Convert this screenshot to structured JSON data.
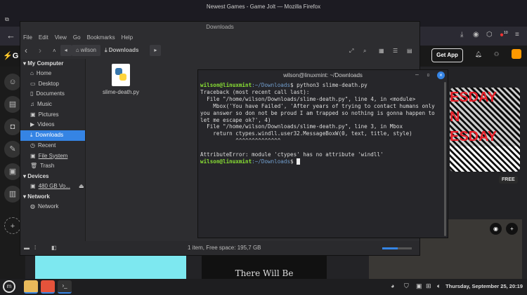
{
  "firefox": {
    "window_title": "Newest Games - Game Jolt — Mozilla Firefox",
    "notif_count": "10",
    "get_app": "Get App",
    "free_badge": "FREE",
    "art_lines": [
      "ESDAY",
      "N",
      "ESDAY"
    ],
    "bottom_art_text": "There Will Be"
  },
  "file_manager": {
    "title": "Downloads",
    "menu": [
      "File",
      "Edit",
      "View",
      "Go",
      "Bookmarks",
      "Help"
    ],
    "breadcrumbs": [
      "wilson",
      "Downloads"
    ],
    "sections": [
      {
        "label": "My Computer",
        "items": [
          "Home",
          "Desktop",
          "Documents",
          "Music",
          "Pictures",
          "Videos",
          "Downloads",
          "Recent",
          "File System",
          "Trash"
        ]
      },
      {
        "label": "Devices",
        "items": [
          "480 GB Vo..."
        ]
      },
      {
        "label": "Network",
        "items": [
          "Network"
        ]
      }
    ],
    "selected": "Downloads",
    "file": "slime-death.py",
    "status": "1 item, Free space: 195,7 GB"
  },
  "terminal": {
    "title": "wilson@linuxmint: ~/Downloads",
    "prompt_user": "wilson@linuxmint",
    "prompt_path": ":~/Downloads",
    "command": "$ python3 slime-death.py",
    "output": "Traceback (most recent call last):\n  File \"/home/wilson/Downloads/slime-death.py\", line 4, in <module>\n    Mbox('You have Failed', 'After years of trying to contact humans only you answer so don not be proud I am trapped so nothing is gonna happen to let me escape ok?', 4)\n  File \"/home/wilson/Downloads/slime-death.py\", line 3, in Mbox\n    return ctypes.windll.user32.MessageBoxW(0, text, title, style)\n           ^^^^^^^^^^^^^^\n\nAttributeError: module 'ctypes' has no attribute 'windll'",
    "prompt_end": "$ "
  },
  "taskbar": {
    "clock": "Thursday, September 25, 20:19"
  }
}
